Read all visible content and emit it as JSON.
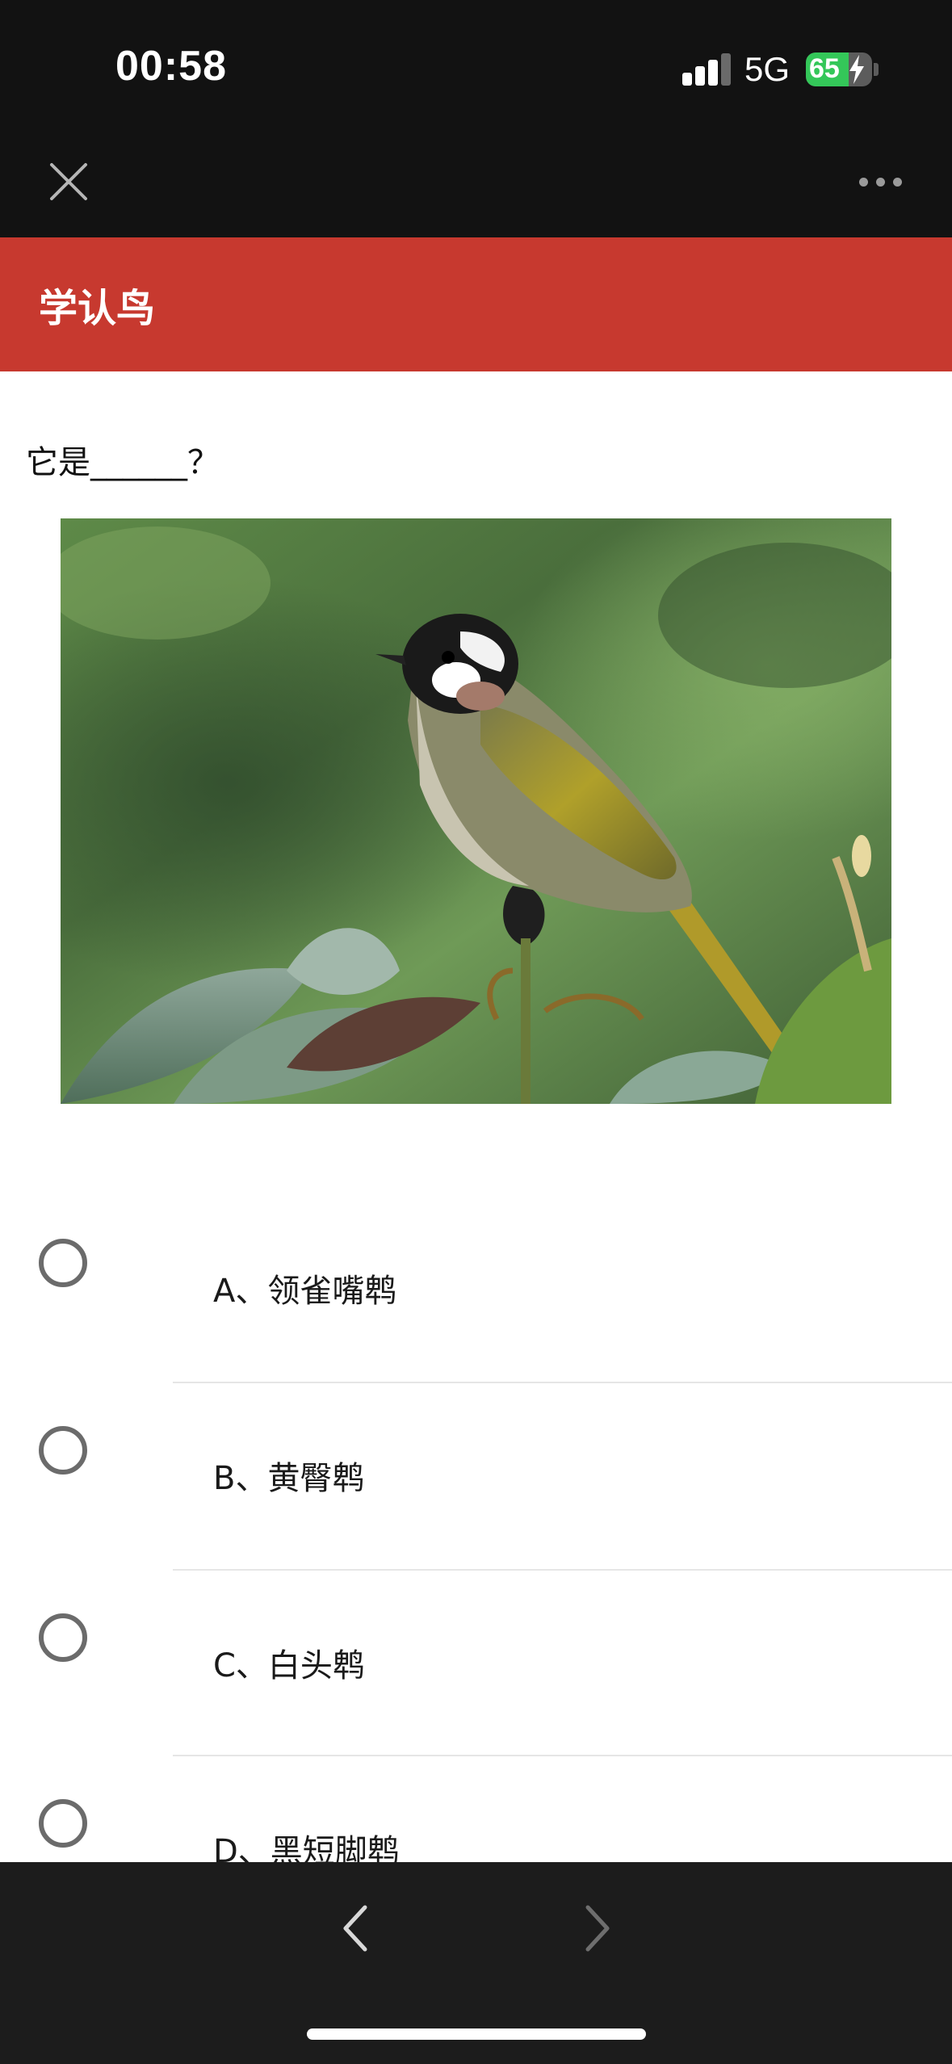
{
  "status_bar": {
    "time": "00:58",
    "network": "5G",
    "battery_percent": "65",
    "battery_level": 0.65,
    "signal_bars_active": 3,
    "signal_bars_total": 4
  },
  "nav": {
    "close_icon": "close-icon",
    "more_icon": "more-dots-icon"
  },
  "header": {
    "title": "学认鸟",
    "background_color": "#c7392f"
  },
  "quiz": {
    "question": "它是______？",
    "options": [
      {
        "label": "A、领雀嘴鹎",
        "selected": false
      },
      {
        "label": "B、黄臀鹎",
        "selected": false
      },
      {
        "label": "C、白头鹎",
        "selected": false
      },
      {
        "label": "D、黑短脚鹎",
        "selected": false
      }
    ]
  },
  "toolbar": {
    "back_icon": "chevron-left-icon",
    "forward_icon": "chevron-right-icon"
  }
}
